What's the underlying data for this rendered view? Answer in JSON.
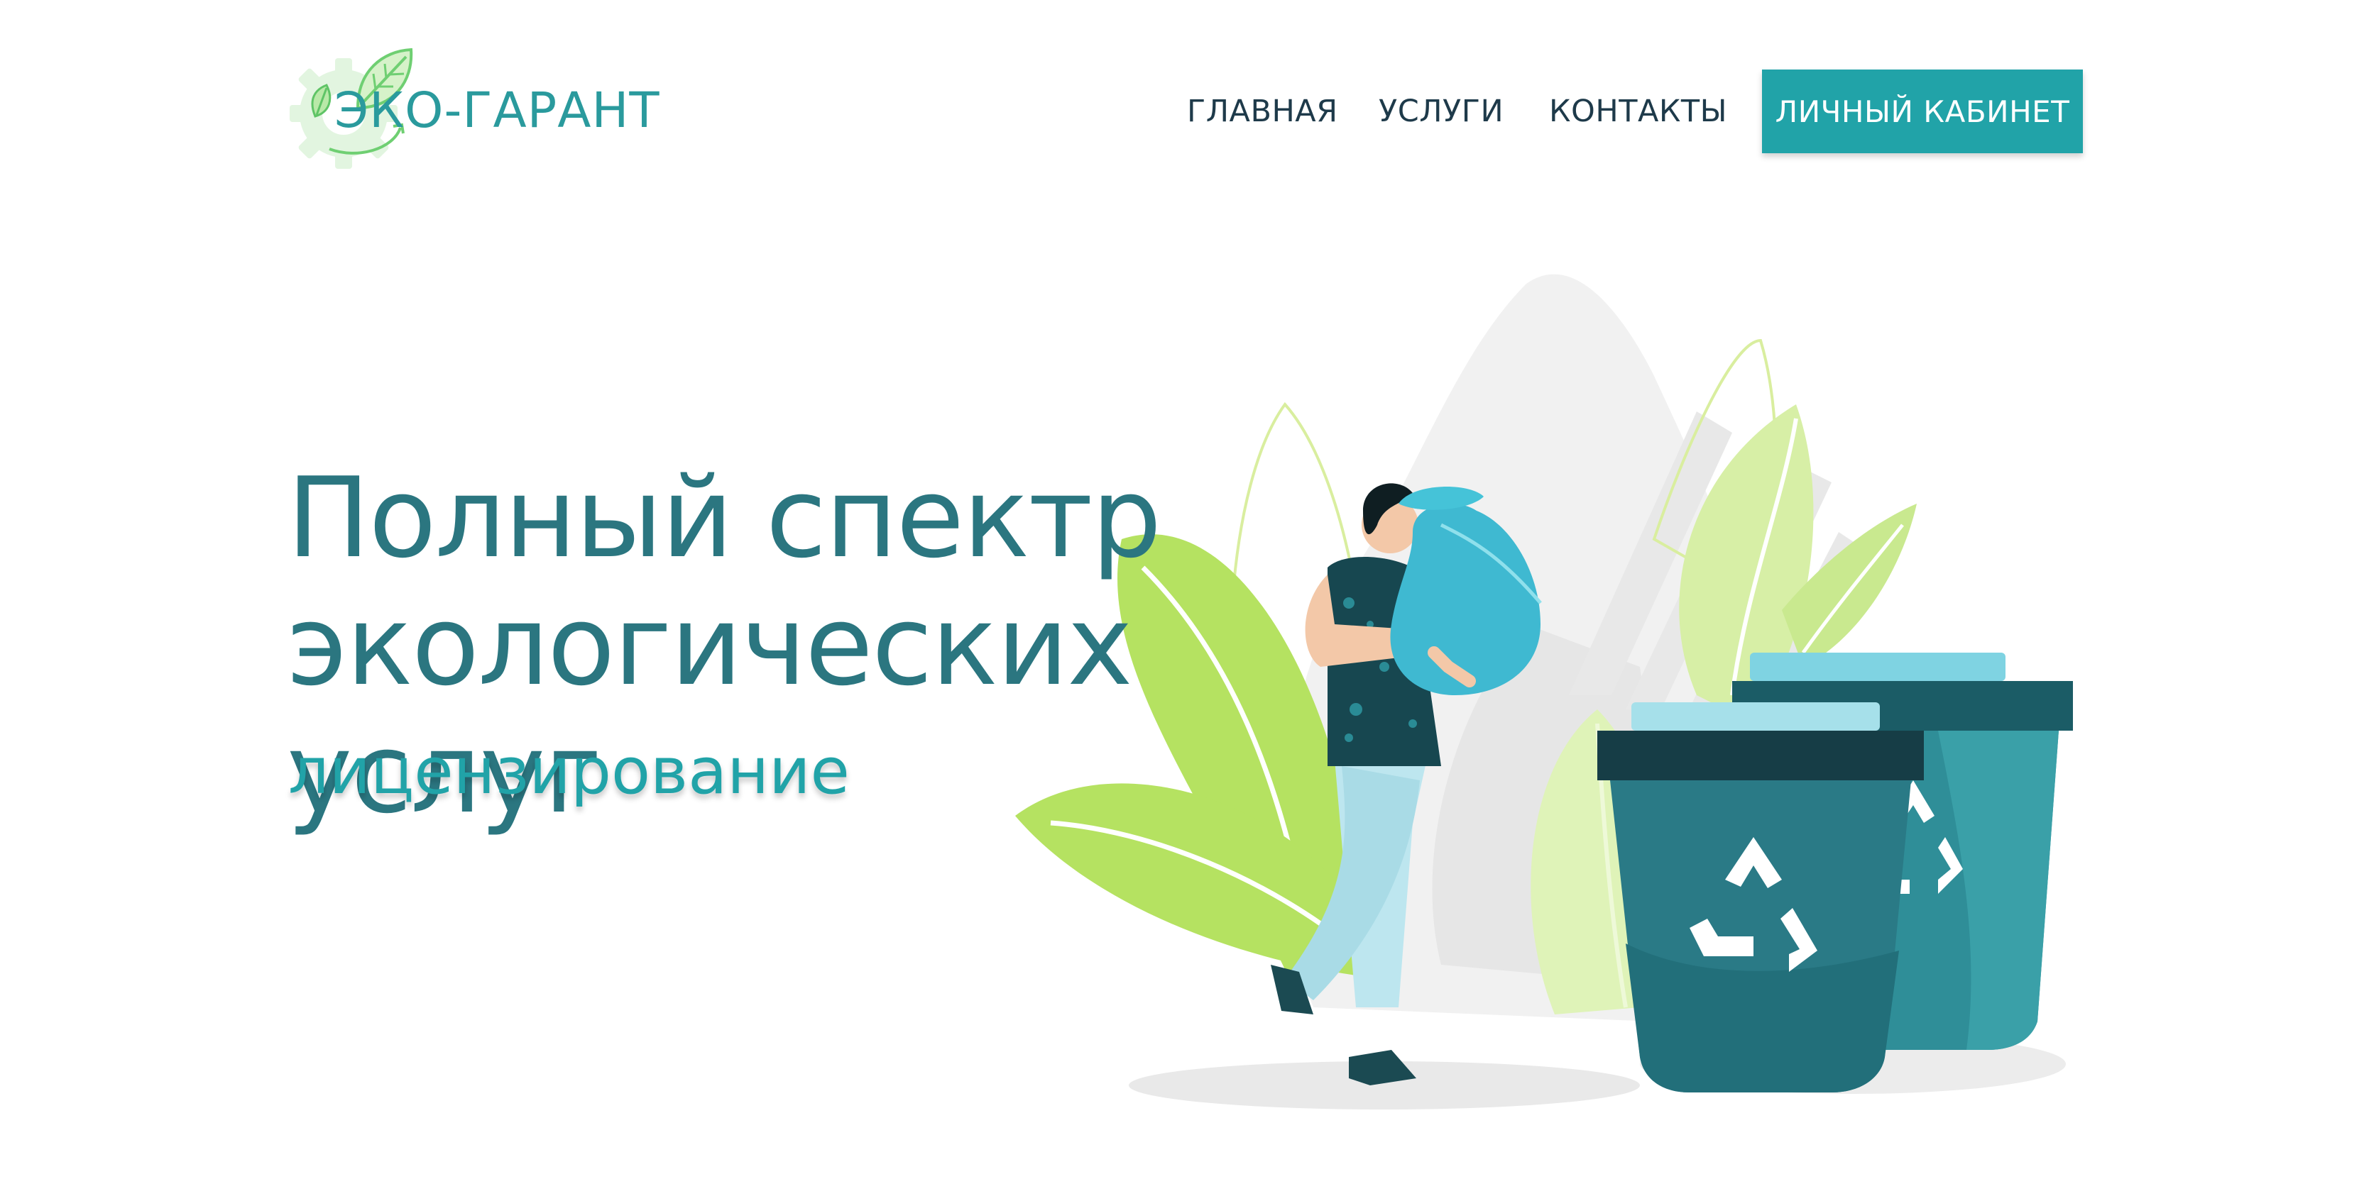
{
  "header": {
    "logo_text": "ЭКО-ГАРАНТ",
    "logo_icon": "leaf-gear-icon",
    "nav": {
      "home": "ГЛАВНАЯ",
      "services": "УСЛУГИ",
      "contacts": "КОНТАКТЫ",
      "account": "ЛИЧНЫЙ КАБИНЕТ"
    }
  },
  "hero": {
    "title_line1": "Полный спектр",
    "title_line2": "экологических услуг",
    "subtitle": "лицензирование",
    "illustration": "person-carrying-trash-bag-to-recycling-bins"
  },
  "colors": {
    "accent": "#21a3a8",
    "title": "#2b7680",
    "nav_text": "#1e3a4a",
    "leaf_green": "#b7e36a",
    "bin_dark": "#2a7a86"
  }
}
